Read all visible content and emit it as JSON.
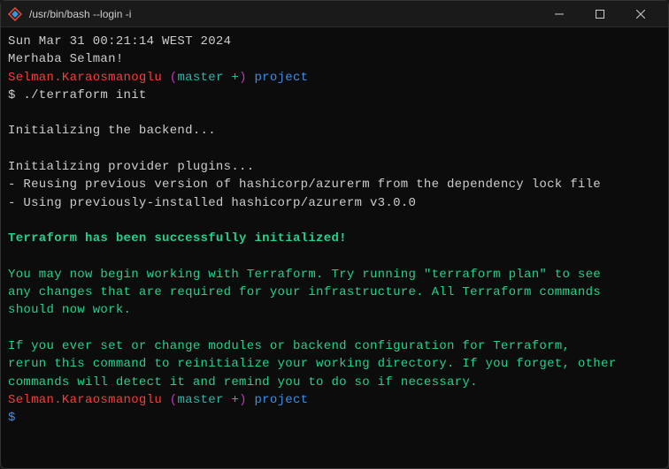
{
  "titlebar": {
    "title": "/usr/bin/bash --login -i"
  },
  "terminal": {
    "date_line": "Sun Mar 31 00:21:14 WEST 2024",
    "greeting": "Merhaba Selman!",
    "prompt1": {
      "user": "Selman.Karaosmanoglu",
      "branch_open": " (",
      "branch": "master +",
      "branch_close": ") ",
      "path": "project"
    },
    "command_line": "$ ./terraform init",
    "init_backend": "Initializing the backend...",
    "init_plugins": "Initializing provider plugins...",
    "reuse_line": "- Reusing previous version of hashicorp/azurerm from the dependency lock file",
    "using_line": "- Using previously-installed hashicorp/azurerm v3.0.0",
    "success_line": "Terraform has been successfully initialized!",
    "para1_l1": "You may now begin working with Terraform. Try running \"terraform plan\" to see",
    "para1_l2": "any changes that are required for your infrastructure. All Terraform commands",
    "para1_l3": "should now work.",
    "para2_l1": "If you ever set or change modules or backend configuration for Terraform,",
    "para2_l2": "rerun this command to reinitialize your working directory. If you forget, other",
    "para2_l3": "commands will detect it and remind you to do so if necessary.",
    "prompt2": {
      "user": "Selman.Karaosmanoglu",
      "branch_open": " (",
      "branch": "master +",
      "branch_close": ") ",
      "path": "project"
    },
    "cursor_prompt": "$"
  }
}
